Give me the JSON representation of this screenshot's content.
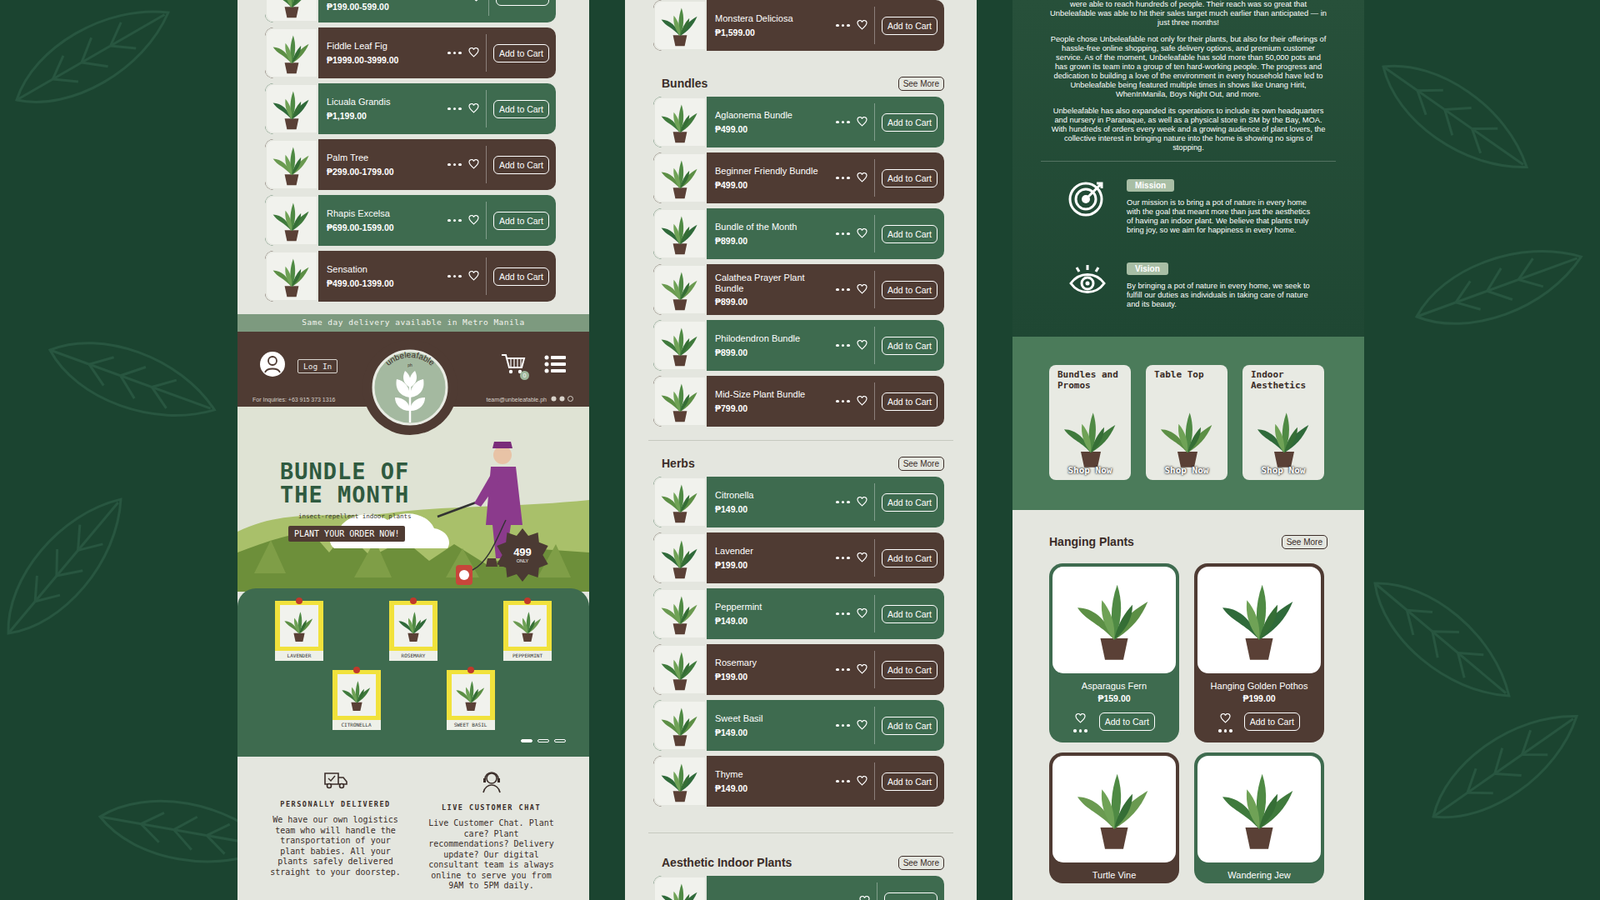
{
  "plant_list": {
    "products": [
      {
        "price": "₱199.00-599.00",
        "color": "#3e6b4f"
      },
      {
        "name": "Fiddle Leaf Fig",
        "price": "₱1999.00-3999.00",
        "button": "Add to Cart",
        "color": "#4f3b33"
      },
      {
        "name": "Licuala Grandis",
        "price": "₱1,199.00",
        "button": "Add to Cart",
        "color": "#3e6b4f"
      },
      {
        "name": "Palm Tree",
        "price": "₱299.00-1799.00",
        "button": "Add to Cart",
        "color": "#4f3b33"
      },
      {
        "name": "Rhapis Excelsa",
        "price": "₱699.00-1599.00",
        "button": "Add to Cart",
        "color": "#3e6b4f"
      },
      {
        "name": "Sensation",
        "price": "₱499.00-1399.00",
        "button": "Add to Cart",
        "color": "#4f3b33"
      }
    ]
  },
  "delivery_banner": "Same day delivery available in Metro Manila",
  "header": {
    "login": "Log In",
    "logo": "unbeleafable",
    "logo_sub": "ph",
    "cart_count": "0",
    "inquiries": "For Inquiries: +63 915 373 1316",
    "email": "team@unbeleafable.ph"
  },
  "hero": {
    "title_line1": "BUNDLE OF",
    "title_line2": "THE MONTH",
    "subtitle": "insect-repellent indoor plants",
    "cta": "PLANT YOUR ORDER NOW!",
    "badge_price": "499",
    "badge_note": "ONLY"
  },
  "gallery": {
    "items": [
      "LAVENDER",
      "ROSEMARY",
      "PEPPERMINT",
      "CITRONELLA",
      "SWEET BASIL"
    ],
    "dots": [
      {
        "selected": true
      },
      {
        "selected": false
      },
      {
        "selected": false
      }
    ]
  },
  "features": [
    {
      "title": "PERSONALLY DELIVERED",
      "text": "We have our own logistics team who will handle the transportation of your plant babies. All your plants safely delivered straight to your doorstep."
    },
    {
      "title": "LIVE CUSTOMER CHAT",
      "text": "Live Customer Chat. Plant care? Plant recommendations? Delivery update? Our digital consultant team is always online to serve you from 9AM to 5PM daily."
    }
  ],
  "shop_page": {
    "top_products": [
      {
        "name": "Monstera Deliciosa",
        "price": "₱1,599.00",
        "button": "Add to Cart",
        "color": "#4f3b33"
      }
    ],
    "sections": [
      {
        "title": "Bundles",
        "see_more": "See More",
        "products": [
          {
            "name": "Aglaonema Bundle",
            "price": "₱499.00",
            "button": "Add to Cart",
            "color": "#3e6b4f"
          },
          {
            "name": "Beginner Friendly Bundle",
            "price": "₱499.00",
            "button": "Add to Cart",
            "color": "#4f3b33"
          },
          {
            "name": "Bundle of the Month",
            "price": "₱899.00",
            "button": "Add to Cart",
            "color": "#3e6b4f"
          },
          {
            "name": "Calathea Prayer Plant Bundle",
            "price": "₱899.00",
            "button": "Add to Cart",
            "color": "#4f3b33"
          },
          {
            "name": "Philodendron Bundle",
            "price": "₱899.00",
            "button": "Add to Cart",
            "color": "#3e6b4f"
          },
          {
            "name": "Mid-Size Plant Bundle",
            "price": "₱799.00",
            "button": "Add to Cart",
            "color": "#4f3b33"
          }
        ]
      },
      {
        "title": "Herbs",
        "see_more": "See More",
        "products": [
          {
            "name": "Citronella",
            "price": "₱149.00",
            "button": "Add to Cart",
            "color": "#3e6b4f"
          },
          {
            "name": "Lavender",
            "price": "₱199.00",
            "button": "Add to Cart",
            "color": "#4f3b33"
          },
          {
            "name": "Peppermint",
            "price": "₱149.00",
            "button": "Add to Cart",
            "color": "#3e6b4f"
          },
          {
            "name": "Rosemary",
            "price": "₱199.00",
            "button": "Add to Cart",
            "color": "#4f3b33"
          },
          {
            "name": "Sweet Basil",
            "price": "₱149.00",
            "button": "Add to Cart",
            "color": "#3e6b4f"
          },
          {
            "name": "Thyme",
            "price": "₱149.00",
            "button": "Add to Cart",
            "color": "#4f3b33"
          }
        ]
      },
      {
        "title": "Aesthetic Indoor Plants",
        "see_more": "See More",
        "products": [
          {
            "color": "#3e6b4f"
          }
        ]
      }
    ]
  },
  "about_page": {
    "paragraphs": [
      "were able to reach hundreds of people. Their reach was so great that Unbeleafable was able to hit their sales target much earlier than anticipated — in just three months!",
      "People chose Unbeleafable not only for their plants, but also for their offerings of hassle-free online shopping, safe delivery options, and premium customer service. As of the moment, Unbeleafable has sold more than 50,000 pots and has grown its team into a group of ten hard-working people. The progress and dedication to building a love of the environment in every household have led to Unbeleafable being featured multiple times in shows like Unang Hirit, WhenInManila, Boys Night Out, and more.",
      "Unbeleafable has also expanded its operations to include its own headquarters and nursery in Paranaque, as well as a physical store in SM by the Bay, MOA. With hundreds of orders every week and a growing audience of plant lovers, the collective interest in bringing nature into the home is showing no signs of stopping."
    ],
    "statements": [
      {
        "label": "Mission",
        "text": "Our mission is to bring a pot of nature in every home with the goal that meant more than just the aesthetics of having an indoor plant. We believe that plants truly bring joy, so we aim for happiness in every home.",
        "kind": "target"
      },
      {
        "label": "Vision",
        "text": "By bringing a pot of nature in every home, we seek to fulfill our duties as individuals in taking care of nature and its beauty.",
        "kind": "eye"
      }
    ],
    "categories": [
      {
        "title": "Bundles and Promos",
        "button": "Shop Now"
      },
      {
        "title": "Table Top",
        "button": "Shop Now"
      },
      {
        "title": "Indoor Aesthetics",
        "button": "Shop Now"
      }
    ],
    "hanging": {
      "title": "Hanging Plants",
      "see_more": "See More",
      "products": [
        {
          "name": "Asparagus Fern",
          "price": "₱159.00",
          "button": "Add to Cart",
          "color": "#3e6b4f"
        },
        {
          "name": "Hanging Golden Pothos",
          "price": "₱199.00",
          "button": "Add to Cart",
          "color": "#4f3b33"
        },
        {
          "name": "Turtle Vine",
          "color": "#4f3b33"
        },
        {
          "name": "Wandering Jew",
          "color": "#3e6b4f"
        }
      ]
    }
  }
}
